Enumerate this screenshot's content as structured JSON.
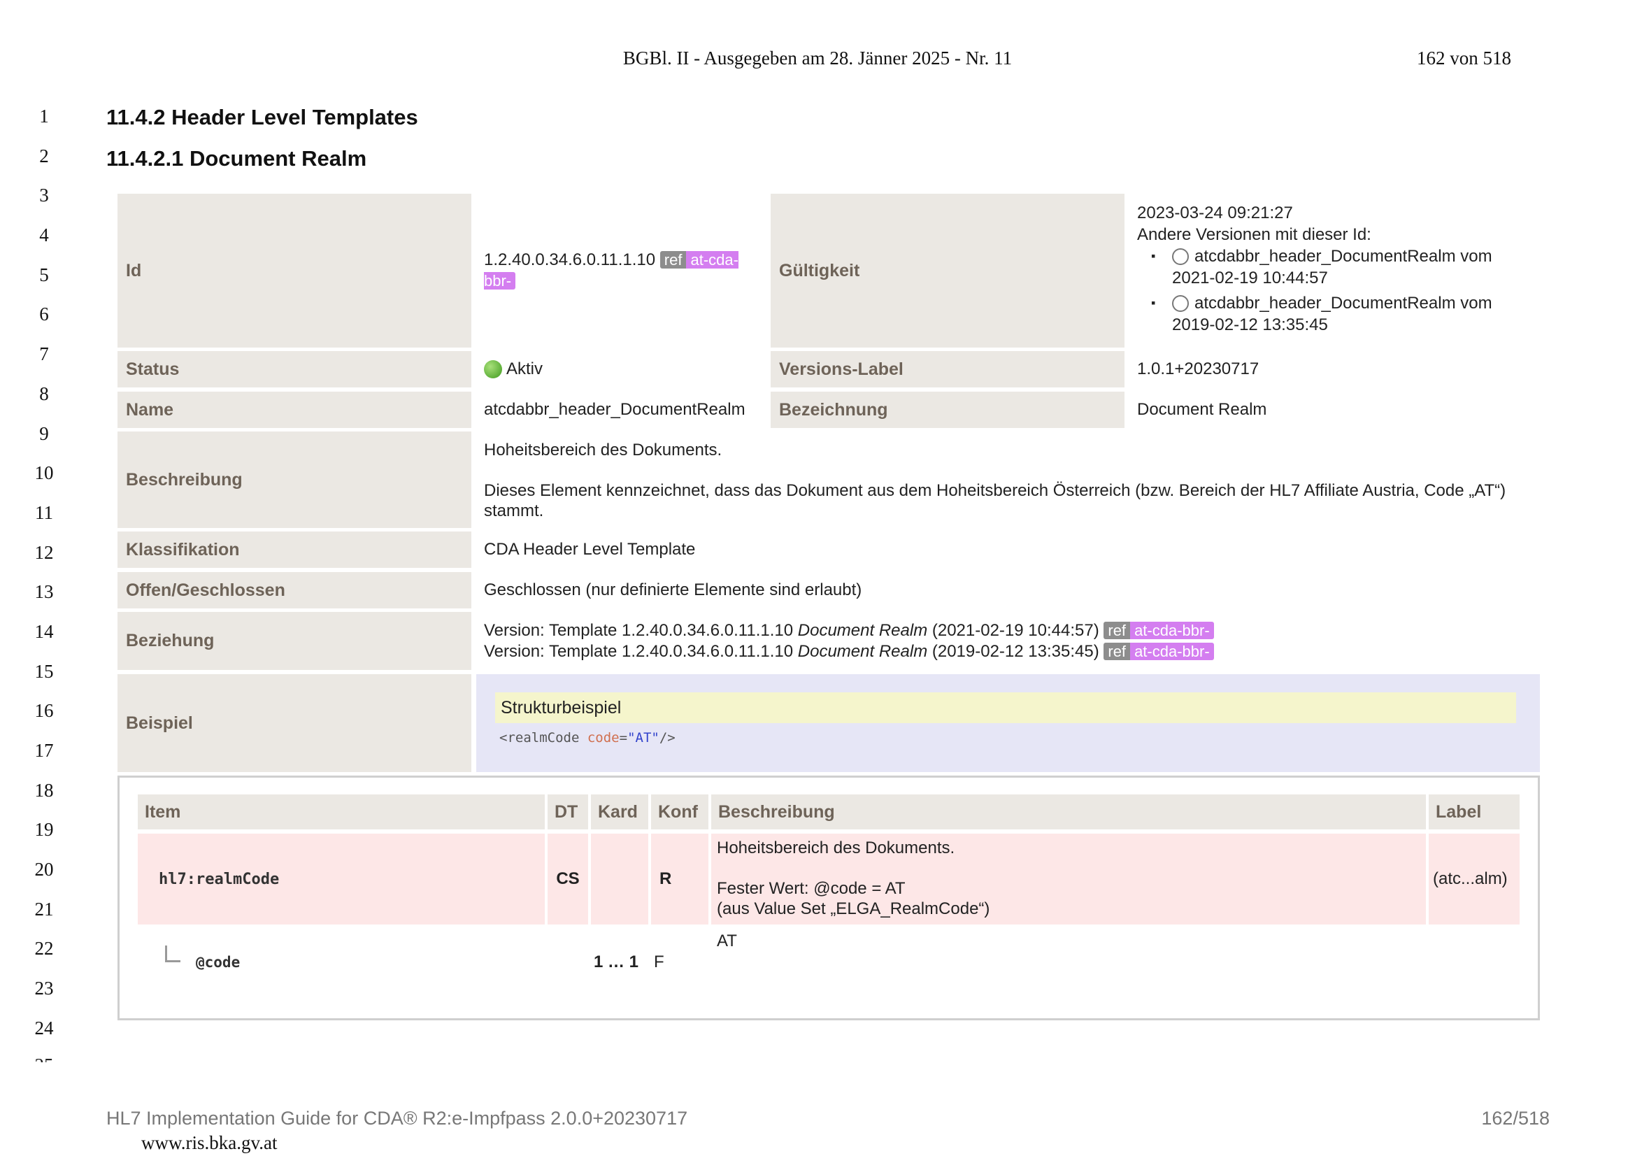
{
  "page_header": {
    "gazette": "BGBl. II - Ausgegeben am 28. Jänner 2025 - Nr. 11",
    "page": "162 von 518"
  },
  "line_numbers": [
    "1",
    "2",
    "3",
    "4",
    "5",
    "6",
    "7",
    "8",
    "9",
    "10",
    "11",
    "12",
    "13",
    "14",
    "15",
    "16",
    "17",
    "18",
    "19",
    "20",
    "21",
    "22",
    "23",
    "24"
  ],
  "headings": {
    "h1": "11.4.2 Header Level Templates",
    "h2": "11.4.2.1 Document Realm"
  },
  "template": {
    "id_label": "Id",
    "id_value": "1.2.40.0.34.6.0.11.1.10",
    "ref_tag": "ref",
    "project_tag": "at-cda-bbr-",
    "validity_label": "Gültigkeit",
    "validity_date": "2023-03-24 09:21:27",
    "other_versions_label": "Andere Versionen mit dieser Id:",
    "other_versions": [
      {
        "name": "atcdabbr_header_DocumentRealm vom",
        "date": "2021-02-19 10:44:57"
      },
      {
        "name": "atcdabbr_header_DocumentRealm vom",
        "date": "2019-02-12 13:35:45"
      }
    ],
    "status_label": "Status",
    "status_value": "Aktiv",
    "versions_label_label": "Versions-Label",
    "versions_label_value": "1.0.1+20230717",
    "name_label": "Name",
    "name_value": "atcdabbr_header_DocumentRealm",
    "bezeichnung_label": "Bezeichnung",
    "bezeichnung_value": "Document Realm",
    "beschreibung_label": "Beschreibung",
    "beschreibung_p1": "Hoheitsbereich des Dokuments.",
    "beschreibung_p2": "Dieses Element kennzeichnet, dass das Dokument aus dem Hoheitsbereich Österreich (bzw. Bereich der HL7 Affiliate Austria, Code „AT“) stammt.",
    "klassifikation_label": "Klassifikation",
    "klassifikation_value": "CDA Header Level Template",
    "offen_label": "Offen/Geschlossen",
    "offen_value": "Geschlossen (nur definierte Elemente sind erlaubt)",
    "beziehung_label": "Beziehung",
    "beziehung": [
      {
        "prefix": "Version: Template 1.2.40.0.34.6.0.11.1.10",
        "title": "Document Realm",
        "date": "(2021-02-19 10:44:57)"
      },
      {
        "prefix": "Version: Template 1.2.40.0.34.6.0.11.1.10",
        "title": "Document Realm",
        "date": "(2019-02-12 13:35:45)"
      }
    ],
    "beispiel_label": "Beispiel",
    "beispiel_title": "Strukturbeispiel",
    "code": {
      "open": "<realmCode ",
      "attr": "code",
      "eq": "=",
      "val": "\"AT\"",
      "close": "/>"
    }
  },
  "item_table": {
    "headers": {
      "item": "Item",
      "dt": "DT",
      "kard": "Kard",
      "konf": "Konf",
      "desc": "Beschreibung",
      "label": "Label"
    },
    "row1": {
      "item": "hl7:realmCode",
      "dt": "CS",
      "kard": "",
      "konf": "R",
      "desc1": "Hoheitsbereich des Dokuments.",
      "desc2": "Fester Wert: @code = AT",
      "desc3": "(aus Value Set „ELGA_RealmCode“)",
      "label": "(atc...alm)"
    },
    "row2": {
      "item": "@code",
      "kard": "1 … 1",
      "konf": "F",
      "desc": "AT"
    }
  },
  "footer": {
    "left": "HL7 Implementation Guide for CDA® R2:e-Impfpass 2.0.0+20230717",
    "right": "162/518",
    "url": "www.ris.bka.gv.at"
  }
}
